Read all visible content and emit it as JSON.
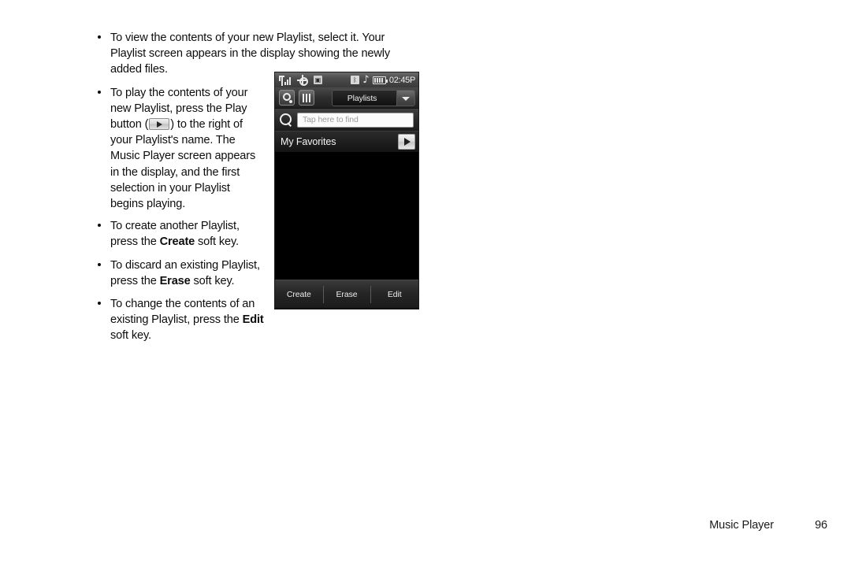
{
  "document": {
    "bullets": [
      {
        "id": "view-contents",
        "text": "To view the contents of your new Playlist, select it. Your Playlist screen appears in the display showing the newly added files."
      },
      {
        "id": "play-contents",
        "text_part1": "To play the contents of your new Playlist, press the Play button (",
        "inline_icon": "play-button-icon",
        "text_part2": ") to the right of your Playlist's name. The Music Player screen appears in the display, and the first selection in your Playlist begins playing."
      },
      {
        "id": "create-playlist",
        "text_part1": "To create another Playlist, press the ",
        "bold": "Create",
        "text_part2": " soft key."
      },
      {
        "id": "discard-playlist",
        "text_part1": "To discard an existing Playlist, press the ",
        "bold": "Erase",
        "text_part2": " soft key."
      },
      {
        "id": "change-contents",
        "text_part1": "To change the contents of an existing Playlist, press the ",
        "bold": "Edit",
        "text_part2": " soft key."
      }
    ]
  },
  "phone": {
    "statusbar": {
      "icons_left": [
        "signal-icon",
        "gps-icon",
        "alarm-icon"
      ],
      "icons_right": [
        "bluetooth-icon",
        "music-note-icon",
        "battery-icon"
      ],
      "bluetooth_glyph": "ᛒ",
      "alarm_glyph": "▣",
      "note_glyph": "♪",
      "time": "02:45P"
    },
    "toolbar": {
      "music_button": "music-library-icon",
      "grid_button": "grid-view-icon",
      "dropdown_label": "Playlists"
    },
    "search": {
      "icon": "search-icon",
      "placeholder": "Tap here to find",
      "value": ""
    },
    "list": {
      "items": [
        {
          "name": "My Favorites",
          "action": "play-icon"
        }
      ]
    },
    "softkeys": [
      {
        "label": "Create"
      },
      {
        "label": "Erase"
      },
      {
        "label": "Edit"
      }
    ]
  },
  "footer": {
    "chapter": "Music Player",
    "page": "96"
  }
}
